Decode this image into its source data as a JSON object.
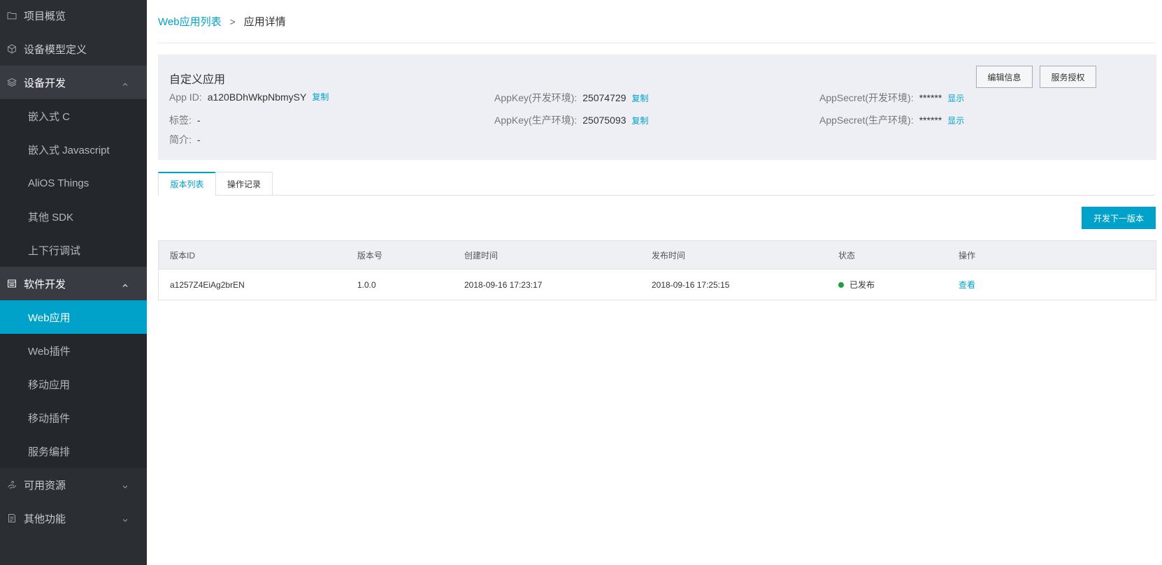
{
  "sidebar": {
    "items": [
      {
        "label": "项目概览",
        "icon": "folder-icon"
      },
      {
        "label": "设备模型定义",
        "icon": "cube-icon"
      },
      {
        "label": "设备开发",
        "icon": "layers-icon"
      },
      {
        "label": "嵌入式 C"
      },
      {
        "label": "嵌入式 Javascript"
      },
      {
        "label": "AliOS Things"
      },
      {
        "label": "其他 SDK"
      },
      {
        "label": "上下行调试"
      },
      {
        "label": "软件开发",
        "icon": "window-icon"
      },
      {
        "label": "Web应用"
      },
      {
        "label": "Web插件"
      },
      {
        "label": "移动应用"
      },
      {
        "label": "移动插件"
      },
      {
        "label": "服务编排"
      },
      {
        "label": "可用资源",
        "icon": "hand-icon"
      },
      {
        "label": "其他功能",
        "icon": "document-icon"
      }
    ]
  },
  "breadcrumb": {
    "parent": "Web应用列表",
    "separator": ">",
    "current": "应用详情"
  },
  "app": {
    "title": "自定义应用",
    "edit_button": "编辑信息",
    "auth_button": "服务授权",
    "app_id_label": "App ID:",
    "app_id_value": "a120BDhWkpNbmySY",
    "copy_label": "复制",
    "tag_label": "标签:",
    "tag_value": "-",
    "desc_label": "简介:",
    "desc_value": "-",
    "appkey_dev_label": "AppKey(开发环境):",
    "appkey_dev_value": "25074729",
    "appkey_prod_label": "AppKey(生产环境):",
    "appkey_prod_value": "25075093",
    "secret_dev_label": "AppSecret(开发环境):",
    "secret_dev_value": "******",
    "secret_prod_label": "AppSecret(生产环境):",
    "secret_prod_value": "******",
    "show_label": "显示"
  },
  "tabs": [
    {
      "label": "版本列表",
      "active": true
    },
    {
      "label": "操作记录",
      "active": false
    }
  ],
  "new_version_button": "开发下一版本",
  "table": {
    "columns": [
      "版本ID",
      "版本号",
      "创建时间",
      "发布时间",
      "状态",
      "操作"
    ],
    "rows": [
      {
        "version_id": "a1257Z4EiAg2brEN",
        "version": "1.0.0",
        "created": "2018-09-16 17:23:17",
        "published": "2018-09-16 17:25:15",
        "status": "已发布",
        "action": "查看"
      }
    ]
  },
  "colors": {
    "accent": "#00a2ca",
    "sidebar_bg": "#2b2e33",
    "status_published": "#1e9f3b"
  }
}
